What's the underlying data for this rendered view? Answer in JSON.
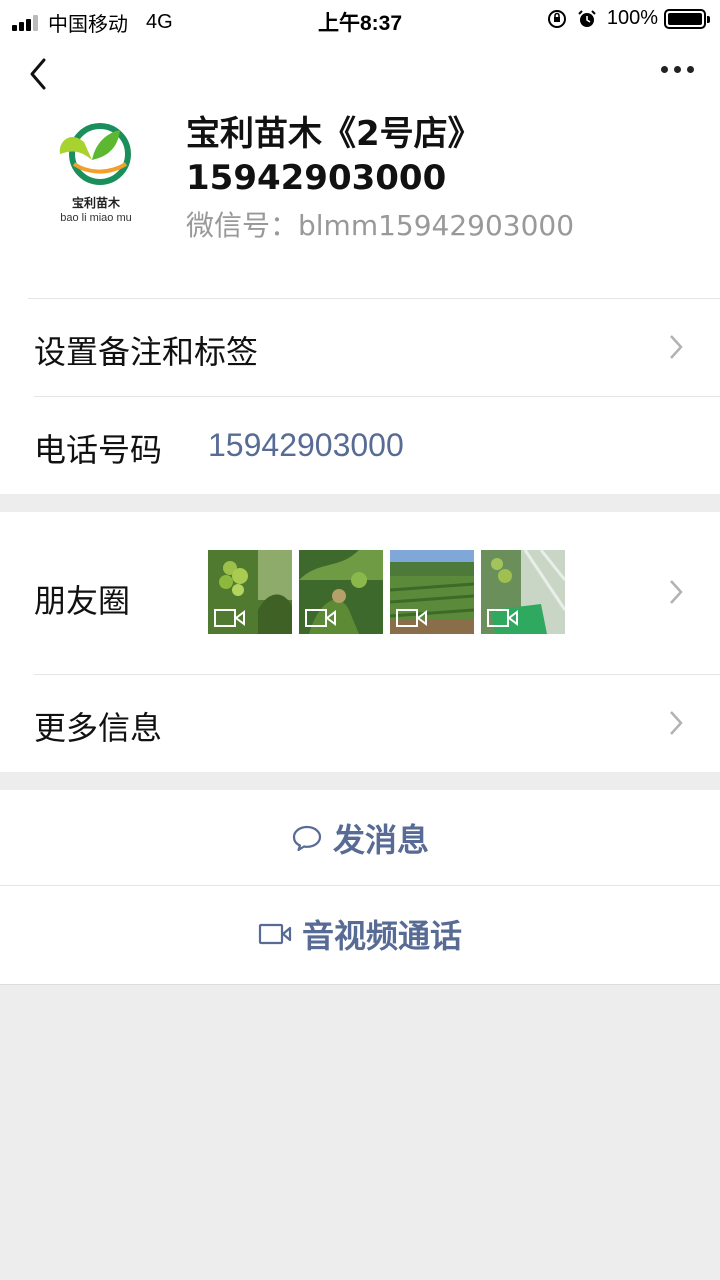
{
  "status_bar": {
    "carrier": "中国移动",
    "network": "4G",
    "time": "上午8:37",
    "battery": "100%"
  },
  "profile": {
    "avatar_title": "宝利苗木",
    "avatar_subtitle": "bao li miao mu",
    "name": "宝利苗木《2号店》15942903000",
    "wechat_id": "微信号：blmm15942903000"
  },
  "rows": {
    "remark_label": "设置备注和标签",
    "phone_label": "电话号码",
    "phone_value": "15942903000",
    "moments_label": "朋友圈",
    "more_info_label": "更多信息"
  },
  "actions": {
    "message": "发消息",
    "call": "音视频通话"
  },
  "colors": {
    "link_blue": "#576b95",
    "background": "#ededed"
  },
  "icons": [
    "back-icon",
    "more-icon",
    "chevron-right-icon",
    "video-icon",
    "chat-bubble-icon",
    "video-call-icon"
  ]
}
